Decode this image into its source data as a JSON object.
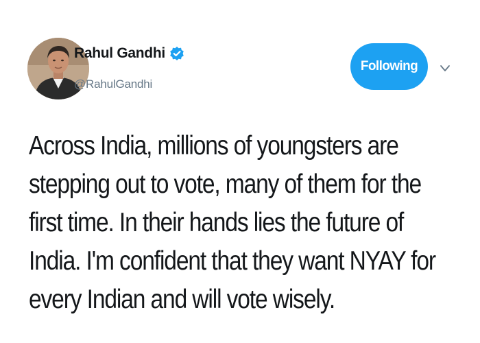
{
  "author": {
    "name": "Rahul Gandhi",
    "handle": "@RahulGandhi",
    "verified": true,
    "avatar_icon": "profile-photo"
  },
  "actions": {
    "follow_label": "Following",
    "menu_icon": "chevron-down-icon"
  },
  "tweet": {
    "lines": [
      "Across India, millions of youngsters are",
      "stepping out to vote, many of them for the",
      "first time. In their hands lies the future of",
      "India. I'm confident that they want NYAY for",
      "every Indian and will vote wisely."
    ]
  },
  "colors": {
    "accent": "#1da1f2",
    "text": "#14171a",
    "secondary_text": "#657786"
  }
}
